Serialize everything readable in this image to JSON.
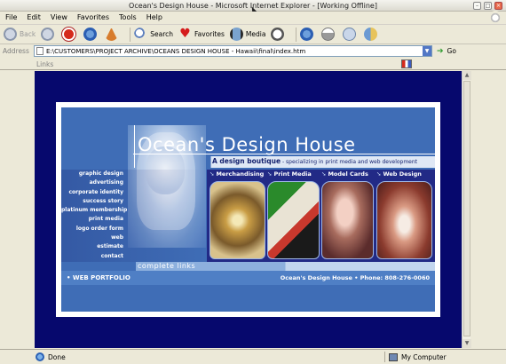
{
  "window": {
    "title": "Ocean's Design House - Microsoft Internet Explorer - [Working Offline]"
  },
  "menu": [
    "File",
    "Edit",
    "View",
    "Favorites",
    "Tools",
    "Help"
  ],
  "toolbar": {
    "back_label": "Back",
    "search_label": "Search",
    "favorites_label": "Favorites",
    "media_label": "Media"
  },
  "address": {
    "label": "Address",
    "value": "E:\\CUSTOMERS\\PROJECT ARCHIVE\\OCEANS DESIGN HOUSE - Hawaii\\final\\index.htm",
    "go_label": "Go"
  },
  "links_label": "Links",
  "site": {
    "title": "Ocean's Design House",
    "tagline": "A design boutique",
    "tagline_sub": " - specializing in print media and web development",
    "nav": [
      "graphic design",
      "advertising",
      "corporate identity",
      "success story",
      "platinum membership",
      "print media",
      "logo order form",
      "web",
      "estimate",
      "contact"
    ],
    "categories": [
      "Merchandising",
      "Print Media",
      "Model Cards",
      "Web Design"
    ],
    "complete_links": "complete links",
    "portfolio": "• WEB PORTFOLIO",
    "contact_line": "Ocean's Design House • Phone: 808-276-0060"
  },
  "status": {
    "text": "Done",
    "zone": "My Computer"
  }
}
